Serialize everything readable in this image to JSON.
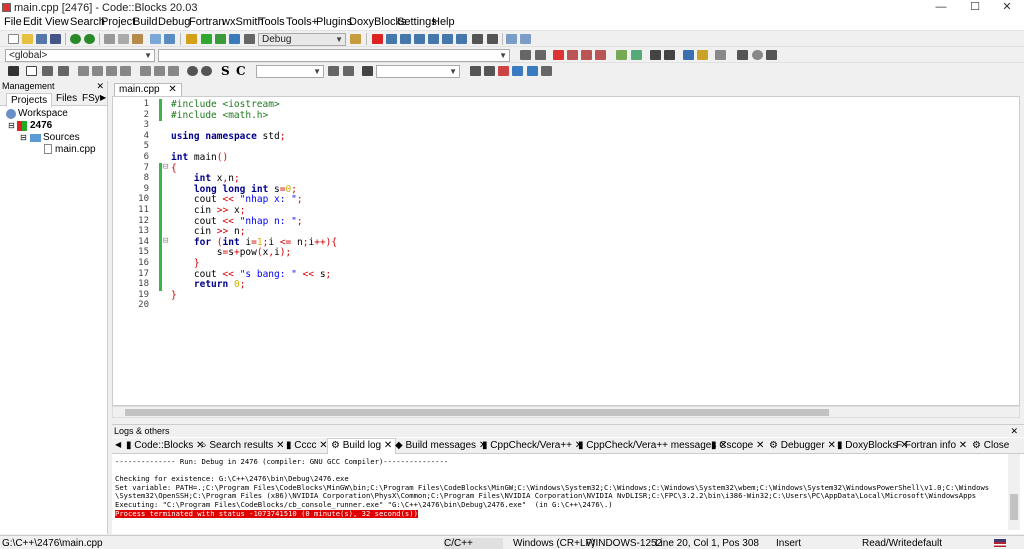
{
  "window": {
    "title": "main.cpp [2476] - Code::Blocks 20.03",
    "minimize": "—",
    "maximize": "☐",
    "close": "✕"
  },
  "menu": [
    "File",
    "Edit",
    "View",
    "Search",
    "Project",
    "Build",
    "Debug",
    "Fortran",
    "wxSmith",
    "Tools",
    "Tools+",
    "Plugins",
    "DoxyBlocks",
    "Settings",
    "Help"
  ],
  "toolbar": {
    "build_target": "Debug",
    "scope": "<global>",
    "search_combo": "",
    "search_combo2": ""
  },
  "management": {
    "title": "Management",
    "tabs": [
      "Projects",
      "Files",
      "FSy"
    ],
    "tree": {
      "workspace": "Workspace",
      "project": "2476",
      "folder": "Sources",
      "file": "main.cpp"
    }
  },
  "editor": {
    "tab": "main.cpp",
    "lines": [
      "#include <iostream>",
      "#include <math.h>",
      "",
      "using namespace std;",
      "",
      "int main()",
      "{",
      "    int x,n;",
      "    long long int s=0;",
      "    cout << \"nhap x: \";",
      "    cin >> x;",
      "    cout << \"nhap n: \";",
      "    cin >> n;",
      "    for (int i=1;i <= n;i++){",
      "        s=s+pow(x,i);",
      "    }",
      "    cout << \"s bang: \" << s;",
      "    return 0;",
      "}",
      ""
    ]
  },
  "logs": {
    "title": "Logs & others",
    "tabs": [
      "Code::Blocks",
      "Search results",
      "Cccc",
      "Build log",
      "Build messages",
      "CppCheck/Vera++",
      "CppCheck/Vera++ messages",
      "Cscope",
      "Debugger",
      "DoxyBlocks",
      "Fortran info",
      "Close"
    ],
    "active_tab": "Build log",
    "output": [
      "-------------- Run: Debug in 2476 (compiler: GNU GCC Compiler)---------------",
      "",
      "Checking for existence: G:\\C++\\2476\\bin\\Debug\\2476.exe",
      "Set variable: PATH=.;C:\\Program Files\\CodeBlocks\\MinGW\\bin;C:\\Program Files\\CodeBlocks\\MinGW;C:\\Windows\\System32;C:\\Windows;C:\\Windows\\System32\\wbem;C:\\Windows\\System32\\WindowsPowerShell\\v1.0;C:\\Windows",
      "\\System32\\OpenSSH;C:\\Program Files (x86)\\NVIDIA Corporation\\PhysX\\Common;C:\\Program Files\\NVIDIA Corporation\\NVIDIA NvDLISR;C:\\FPC\\3.2.2\\bin\\i386-Win32;C:\\Users\\PC\\AppData\\Local\\Microsoft\\WindowsApps",
      "Executing: \"C:\\Program Files\\CodeBlocks/cb_console_runner.exe\" \"G:\\C++\\2476\\bin\\Debug\\2476.exe\"  (in G:\\C++\\2476\\.)",
      "Process terminated with status -1073741510 (0 minute(s), 32 second(s))"
    ]
  },
  "status": {
    "path": "G:\\C++\\2476\\main.cpp",
    "language": "C/C++",
    "eol": "Windows (CR+LF)",
    "encoding": "WINDOWS-1252",
    "position": "Line 20, Col 1, Pos 308",
    "mode": "Insert",
    "access": "Read/Write",
    "profile": "default"
  },
  "colors": {
    "error_bg": "#e00000",
    "changed_marker": "#3cb44b",
    "keyword": "#00008b",
    "preprocessor": "#1f7a1f",
    "string": "#0000ff"
  }
}
